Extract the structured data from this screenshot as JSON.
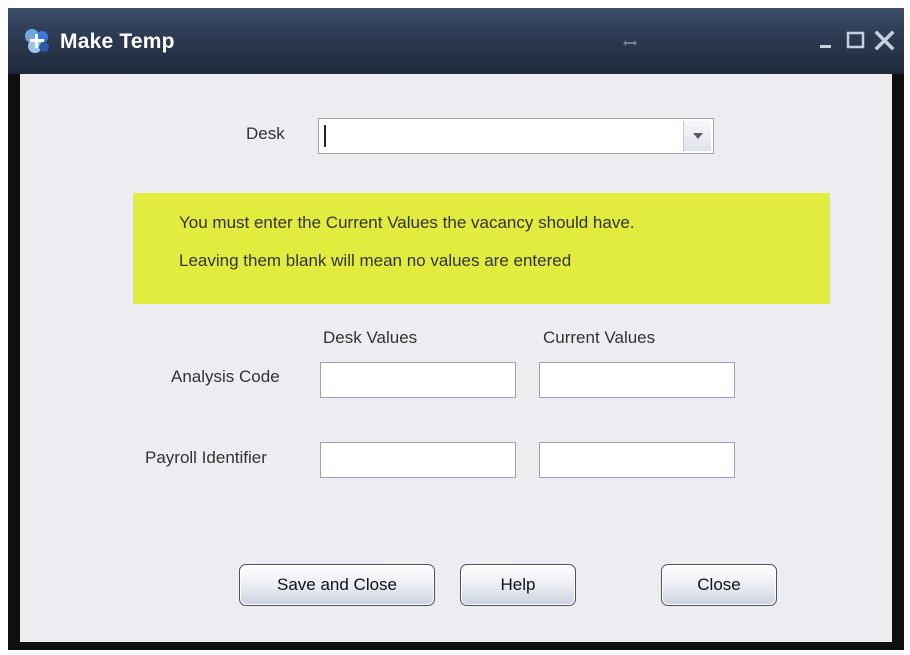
{
  "window": {
    "title": "Make Temp"
  },
  "form": {
    "desk_label": "Desk",
    "desk_value": "",
    "notice_line1": "You must enter the Current Values the vacancy should have.",
    "notice_line2": "Leaving them blank will mean no values are entered",
    "notice_color": "#e2ec3e",
    "col_desk_values": "Desk Values",
    "col_current_values": "Current Values",
    "rows": [
      {
        "label": "Analysis Code",
        "desk_value": "",
        "current_value": ""
      },
      {
        "label": "Payroll Identifier",
        "desk_value": "",
        "current_value": ""
      }
    ]
  },
  "buttons": {
    "save_close": "Save and Close",
    "help": "Help",
    "close": "Close"
  },
  "icons": {
    "app": "app-logo-icon",
    "resize": "resize-horizontal-icon",
    "minimize": "minimize-icon",
    "maximize": "maximize-icon",
    "close": "close-icon",
    "dropdown": "chevron-down-icon"
  }
}
